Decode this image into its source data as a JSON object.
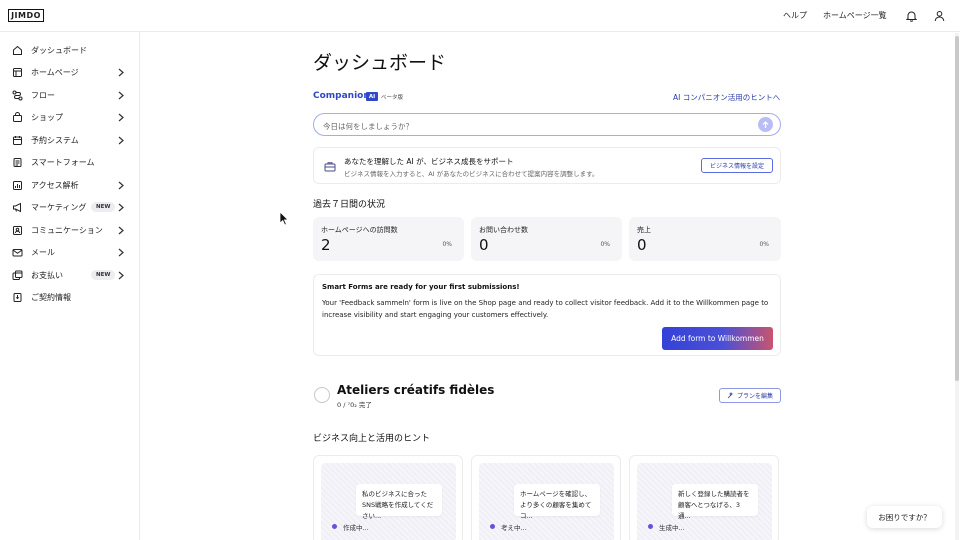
{
  "header": {
    "logo": "JIMDO",
    "help": "ヘルプ",
    "sites": "ホームページ一覧",
    "icons": [
      "bell-icon",
      "user-icon"
    ]
  },
  "sidebar": {
    "items": [
      {
        "label": "ダッシュボード",
        "icon": "home-icon"
      },
      {
        "label": "ホームページ",
        "icon": "layout-icon",
        "chevron": true
      },
      {
        "label": "フロー",
        "icon": "flow-icon",
        "chevron": true
      },
      {
        "label": "ショップ",
        "icon": "bag-icon",
        "chevron": true
      },
      {
        "label": "予約システム",
        "icon": "calendar-icon",
        "chevron": true
      },
      {
        "label": "スマートフォーム",
        "icon": "form-icon"
      },
      {
        "label": "アクセス解析",
        "icon": "chart-icon",
        "chevron": true
      },
      {
        "label": "マーケティング",
        "icon": "megaphone-icon",
        "chevron": true,
        "badge": "NEW"
      },
      {
        "label": "コミュニケーション",
        "icon": "contact-icon",
        "chevron": true
      },
      {
        "label": "メール",
        "icon": "mail-icon",
        "chevron": true
      },
      {
        "label": "お支払い",
        "icon": "payment-icon",
        "chevron": true,
        "badge": "NEW"
      },
      {
        "label": "ご契約情報",
        "icon": "contract-icon"
      }
    ]
  },
  "main": {
    "title": "ダッシュボード",
    "companion": {
      "label": "Companion",
      "ai_tag": "AI",
      "beta": "ベータ版",
      "hint_link": "AI コンパニオン活用のヒントへ",
      "placeholder": "今日は何をしましょうか？"
    },
    "support": {
      "title": "あなたを理解した AI が、ビジネス成長をサポート",
      "subtitle": "ビジネス情報を入力すると、AI があなたのビジネスに合わせて提案内容を調整します。",
      "button": "ビジネス情報を設定"
    },
    "stats": {
      "heading": "過去７日間の状況",
      "items": [
        {
          "label": "ホームページへの訪問数",
          "value": "2",
          "pct": "0%"
        },
        {
          "label": "お問い合わせ数",
          "value": "0",
          "pct": "0%"
        },
        {
          "label": "売上",
          "value": "0",
          "pct": "0%"
        }
      ]
    },
    "smart_forms": {
      "title": "Smart Forms are ready for your first submissions!",
      "body": "Your 'Feedback sammeln' form is live on the Shop page and ready to collect visitor feedback. Add it to the Willkommen page to increase visibility and start engaging your customers effectively.",
      "button": "Add form to Willkommen"
    },
    "plan": {
      "title": "Ateliers créatifs fidèles",
      "progress": "0 /  ⁷0₂  完了",
      "button": "プランを編集"
    },
    "tips": {
      "heading": "ビジネス向上と活用のヒント",
      "cards": [
        {
          "text": "私のビジネスに合ったSNS戦略を作成してください...",
          "status": "作成中..."
        },
        {
          "text": "ホームページを確認し、より多くの顧客を集めてコ...",
          "status": "考え中..."
        },
        {
          "text": "新しく登録した購読者を顧客へとつなげる、3通...",
          "status": "生成中..."
        }
      ]
    }
  },
  "help_pill": "お困りですか？",
  "colors": {
    "accent": "#3048c6",
    "border": "#ececec",
    "stat_bg": "#f5f5f7"
  }
}
